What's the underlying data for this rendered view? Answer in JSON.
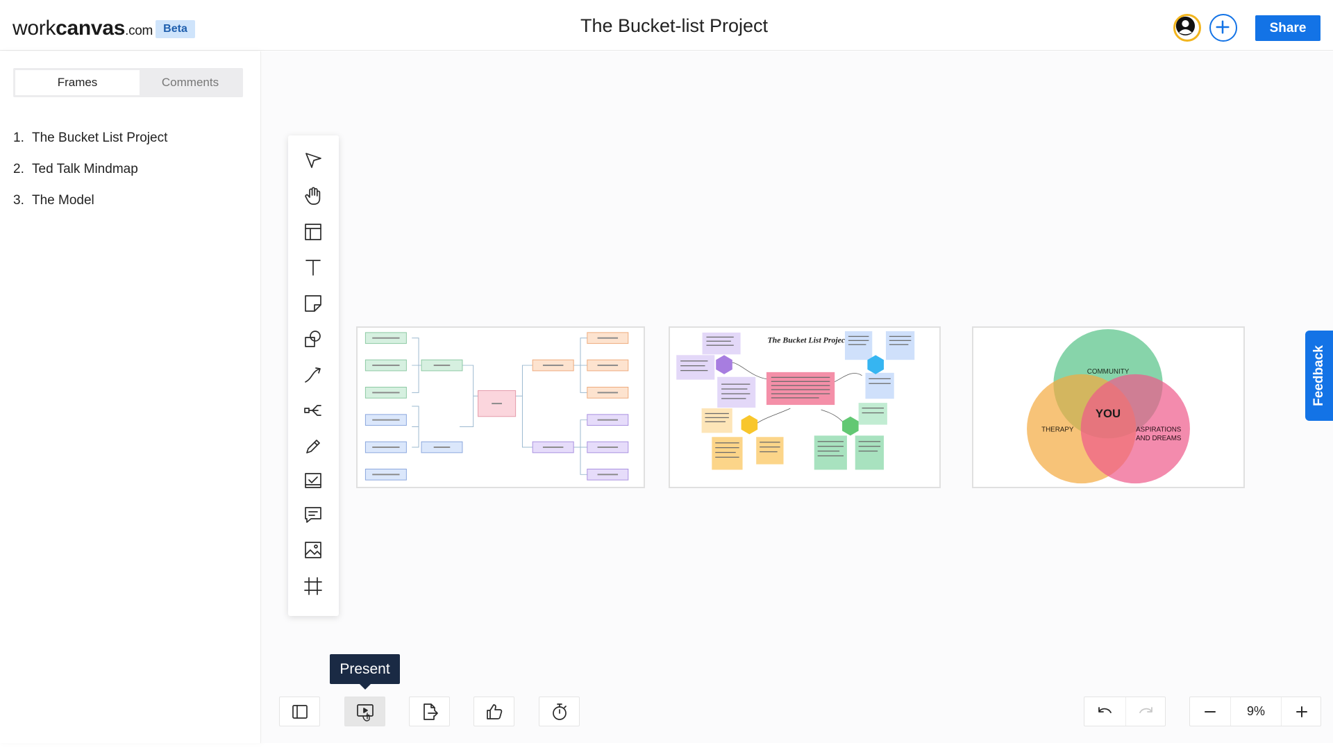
{
  "header": {
    "logo_regular": "work",
    "logo_bold": "canvas",
    "logo_suffix": ".com",
    "badge": "Beta",
    "title": "The Bucket-list Project",
    "share_label": "Share",
    "accent_color": "#1373e6"
  },
  "sidebar": {
    "tabs": [
      {
        "label": "Frames",
        "active": true
      },
      {
        "label": "Comments",
        "active": false
      }
    ],
    "frames": [
      {
        "number": "1.",
        "title": "The Bucket List Project"
      },
      {
        "number": "2.",
        "title": "Ted Talk Mindmap"
      },
      {
        "number": "3.",
        "title": "The Model"
      }
    ]
  },
  "toolbar": {
    "tools": [
      "select-arrow-icon",
      "hand-pan-icon",
      "layout-template-icon",
      "text-icon",
      "sticky-note-icon",
      "shapes-icon",
      "connector-icon",
      "mindmap-icon",
      "pen-icon",
      "checklist-icon",
      "comment-icon",
      "image-icon",
      "frame-icon"
    ]
  },
  "frames_on_canvas": {
    "frame2": {
      "title": "The Bucket List Project"
    },
    "frame3": {
      "circle_top": "COMMUNITY",
      "circle_left": "THERAPY",
      "circle_right_line1": "ASPIRATIONS",
      "circle_right_line2": "AND DREAMS",
      "center": "YOU"
    }
  },
  "feedback_label": "Feedback",
  "bottom_bar": {
    "tooltip": "Present",
    "zoom": "9%",
    "buttons": [
      "toggle-sidebar-icon",
      "present-icon",
      "export-icon",
      "like-icon",
      "timer-icon"
    ]
  }
}
